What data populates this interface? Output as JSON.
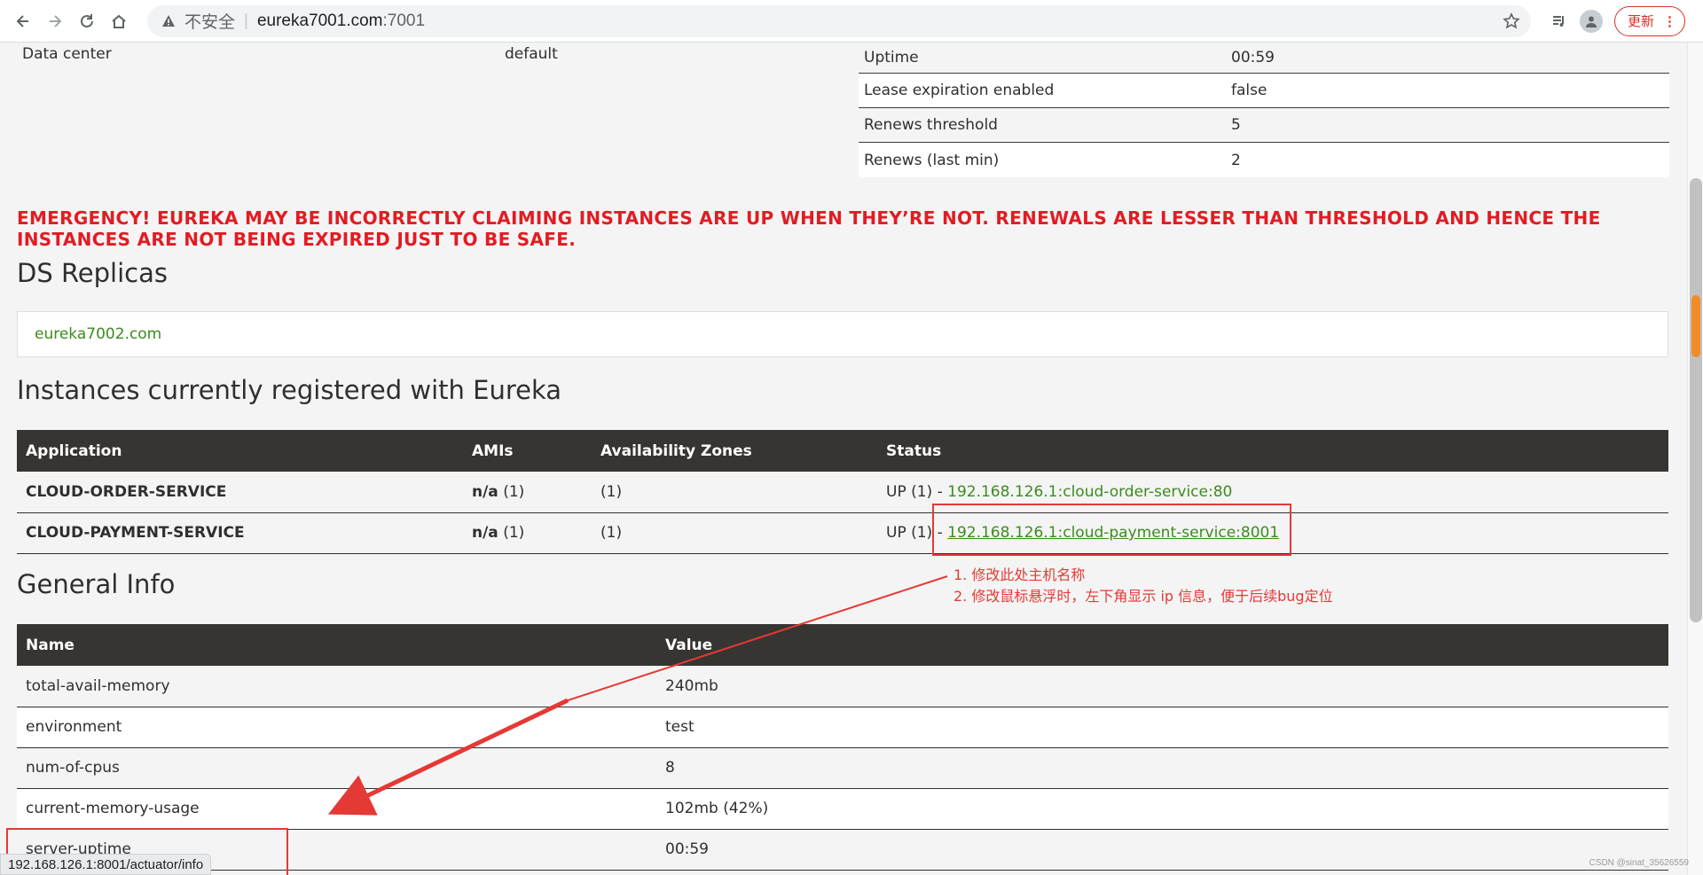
{
  "browser": {
    "insecure_label": "不安全",
    "url_host": "eureka7001.com",
    "url_port": ":7001",
    "update_label": "更新"
  },
  "system": {
    "rows": [
      {
        "label": "Data center",
        "value": "default"
      }
    ]
  },
  "stats": {
    "rows": [
      {
        "k": "Uptime",
        "v": "00:59"
      },
      {
        "k": "Lease expiration enabled",
        "v": "false"
      },
      {
        "k": "Renews threshold",
        "v": "5"
      },
      {
        "k": "Renews (last min)",
        "v": "2"
      }
    ]
  },
  "emergency": "EMERGENCY! EUREKA MAY BE INCORRECTLY CLAIMING INSTANCES ARE UP WHEN THEY’RE NOT. RENEWALS ARE LESSER THAN THRESHOLD AND HENCE THE INSTANCES ARE NOT BEING EXPIRED JUST TO BE SAFE.",
  "replicas": {
    "title": "DS Replicas",
    "items": [
      "eureka7002.com"
    ]
  },
  "instances": {
    "title": "Instances currently registered with Eureka",
    "headers": [
      "Application",
      "AMIs",
      "Availability Zones",
      "Status"
    ],
    "rows": [
      {
        "app": "CLOUD-ORDER-SERVICE",
        "ami_bold": "n/a",
        "ami_count": " (1)",
        "zones": "(1)",
        "status_prefix": "UP (1) - ",
        "status_link": "192.168.126.1:cloud-order-service:80"
      },
      {
        "app": "CLOUD-PAYMENT-SERVICE",
        "ami_bold": "n/a",
        "ami_count": " (1)",
        "zones": "(1)",
        "status_prefix": "UP (1) - ",
        "status_link": "192.168.126.1:cloud-payment-service:8001"
      }
    ]
  },
  "general": {
    "title": "General Info",
    "headers": [
      "Name",
      "Value"
    ],
    "rows": [
      {
        "name": "total-avail-memory",
        "value": "240mb"
      },
      {
        "name": "environment",
        "value": "test"
      },
      {
        "name": "num-of-cpus",
        "value": "8"
      },
      {
        "name": "current-memory-usage",
        "value": "102mb (42%)"
      },
      {
        "name": "server-uptime",
        "value": "00:59"
      }
    ]
  },
  "annotations": {
    "line1": "1. 修改此处主机名称",
    "line2": "2. 修改鼠标悬浮时，左下角显示 ip 信息，便于后续bug定位"
  },
  "status_bar_url": "192.168.126.1:8001/actuator/info",
  "watermark": "CSDN @sinat_35626559",
  "colors": {
    "emergency": "#e31b23",
    "link": "#3d8b1f",
    "table_header": "#373531",
    "annotation": "#e53935"
  }
}
